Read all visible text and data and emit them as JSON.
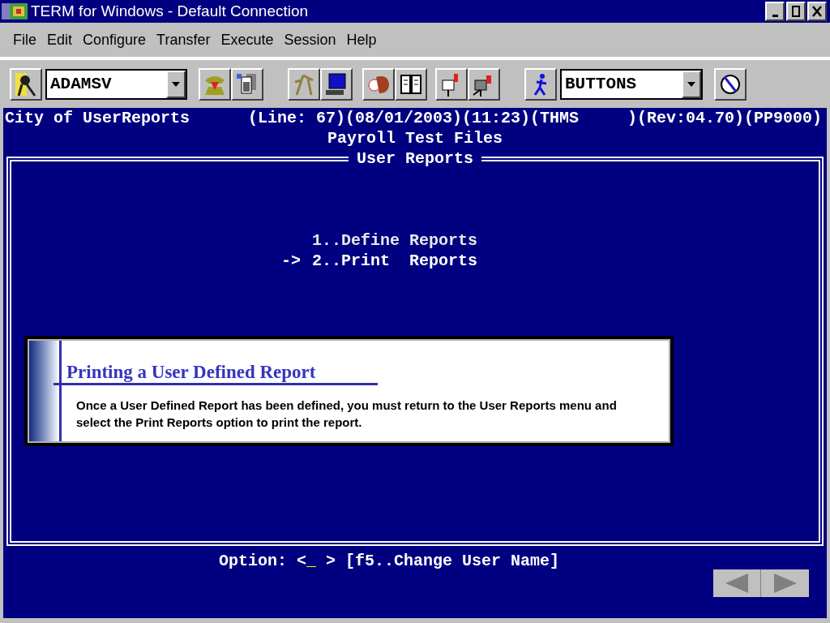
{
  "window": {
    "title": "TERM for Windows - Default Connection"
  },
  "menu": [
    "File",
    "Edit",
    "Configure",
    "Transfer",
    "Execute",
    "Session",
    "Help"
  ],
  "toolbar": {
    "user_combo": {
      "value": "ADAMSV"
    },
    "buttons_combo": {
      "value": "BUTTONS"
    }
  },
  "terminal": {
    "header_left": "City of UserReports",
    "header_right": "(Line: 67)(08/01/2003)(11:23)(THMS     )(Rev:04.70)(PP9000)",
    "subtitle": "Payroll Test Files",
    "frame_title": "User Reports",
    "pointer": "->",
    "options": [
      {
        "text": "1..Define Reports",
        "selected": false
      },
      {
        "text": "2..Print  Reports",
        "selected": true
      }
    ],
    "prompt": {
      "before": "Option: <",
      "cursor": "_",
      "after": " > [f5..Change User Name]"
    }
  },
  "callout": {
    "title": "Printing a User Defined Report",
    "body": "Once a User Defined Report has been defined, you must return to the User Reports menu and select the Print Reports option to print the report."
  }
}
